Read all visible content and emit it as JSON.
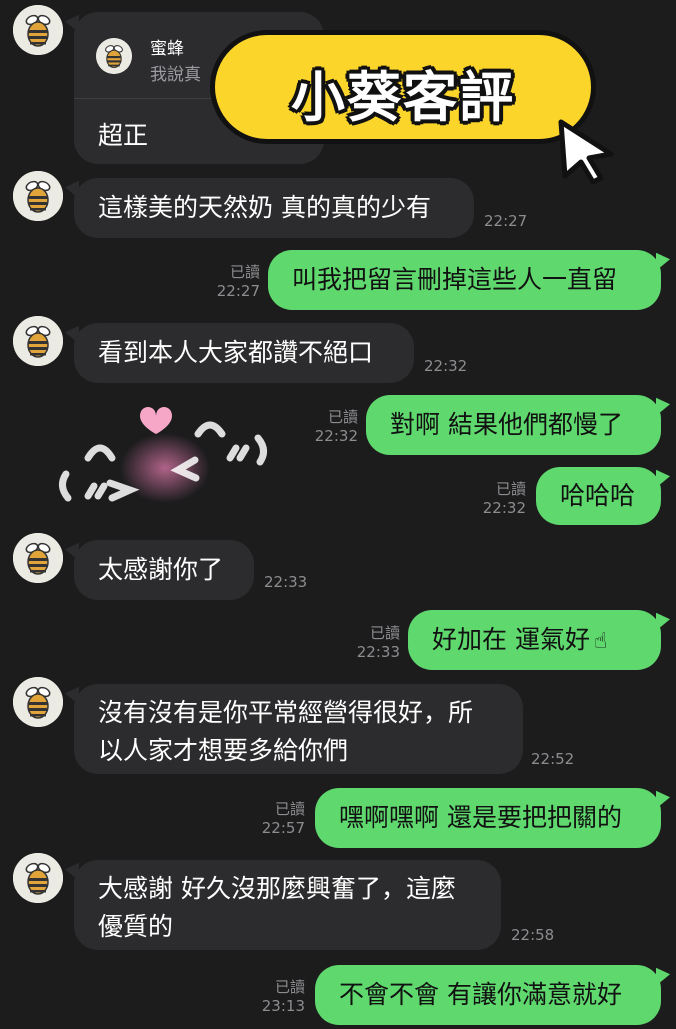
{
  "reply": {
    "name": "蜜蜂",
    "quote": "我說真",
    "text": "超正"
  },
  "banner": {
    "title": "小葵客評"
  },
  "read_label": "已讀",
  "messages": [
    {
      "side": "left",
      "text": "這樣美的天然奶 真的真的少有",
      "time": "22:27"
    },
    {
      "side": "right",
      "text": "叫我把留言刪掉這些人一直留",
      "time": "22:27"
    },
    {
      "side": "left",
      "text": "看到本人大家都讚不絕口",
      "time": "22:32"
    },
    {
      "side": "right",
      "text": "對啊 結果他們都慢了",
      "time": "22:32"
    },
    {
      "side": "right",
      "text": "哈哈哈",
      "time": "22:32"
    },
    {
      "side": "left",
      "text": "太感謝你了",
      "time": "22:33"
    },
    {
      "side": "right",
      "text": "好加在 運氣好",
      "time": "22:33"
    },
    {
      "side": "left",
      "text": "沒有沒有是你平常經營得很好，所",
      "text2": "以人家才想要多給你們",
      "time": "22:52"
    },
    {
      "side": "right",
      "text": "嘿啊嘿啊 還是要把把關的",
      "time": "22:57"
    },
    {
      "side": "left",
      "text": "大感謝 好久沒那麼興奮了，這麼",
      "text2": "優質的",
      "time": "22:58"
    },
    {
      "side": "right",
      "text": "不會不會 有讓你滿意就好",
      "time": "23:13"
    }
  ],
  "sticker": {
    "icon": "blushing-face-sticker",
    "accent": "#f6a7c8"
  },
  "colors": {
    "bg": "#1c1c1d",
    "left_bubble": "#2c2c2e",
    "right_bubble": "#5fd86e",
    "banner": "#fcd52a"
  }
}
